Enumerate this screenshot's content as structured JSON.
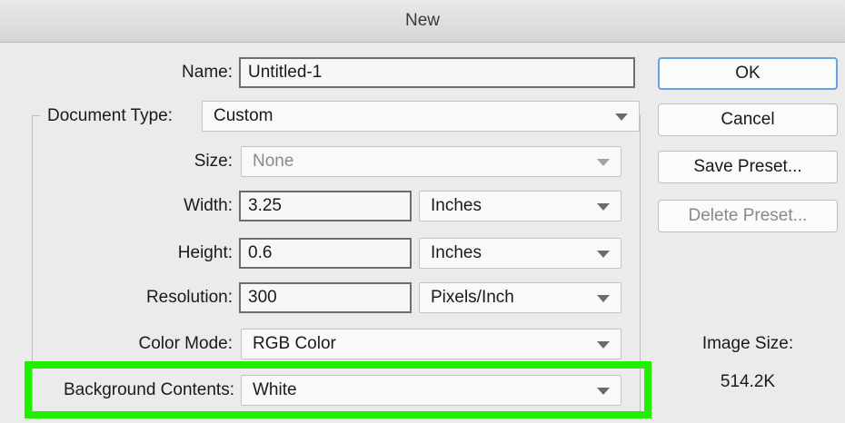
{
  "window": {
    "title": "New"
  },
  "form": {
    "name_label": "Name:",
    "name_value": "Untitled-1",
    "doc_type_label": "Document Type:",
    "doc_type_value": "Custom",
    "size_label": "Size:",
    "size_value": "None",
    "width_label": "Width:",
    "width_value": "3.25",
    "width_unit": "Inches",
    "height_label": "Height:",
    "height_value": "0.6",
    "height_unit": "Inches",
    "resolution_label": "Resolution:",
    "resolution_value": "300",
    "resolution_unit": "Pixels/Inch",
    "color_mode_label": "Color Mode:",
    "color_mode_value": "RGB Color",
    "background_label": "Background Contents:",
    "background_value": "White"
  },
  "buttons": {
    "ok": "OK",
    "cancel": "Cancel",
    "save_preset": "Save Preset...",
    "delete_preset": "Delete Preset..."
  },
  "info": {
    "image_size_label": "Image Size:",
    "image_size_value": "514.2K"
  },
  "colors": {
    "highlight": "#22ee00",
    "default_button_border": "#6aa1e0"
  }
}
